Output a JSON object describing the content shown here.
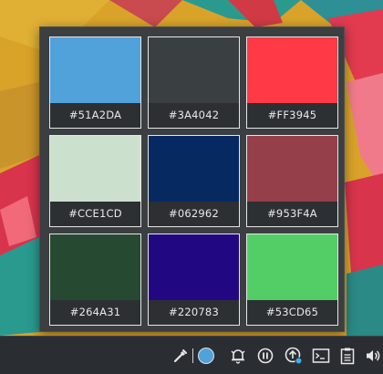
{
  "palette": {
    "swatches": [
      {
        "hex": "#51A2DA",
        "label": "#51A2DA"
      },
      {
        "hex": "#3A4042",
        "label": "#3A4042"
      },
      {
        "hex": "#FF3945",
        "label": "#FF3945"
      },
      {
        "hex": "#CCE1CD",
        "label": "#CCE1CD"
      },
      {
        "hex": "#062962",
        "label": "#062962"
      },
      {
        "hex": "#953F4A",
        "label": "#953F4A"
      },
      {
        "hex": "#264A31",
        "label": "#264A31"
      },
      {
        "hex": "#220783",
        "label": "#220783"
      },
      {
        "hex": "#53CD65",
        "label": "#53CD65"
      }
    ]
  },
  "taskbar": {
    "icons": [
      "color-picker-icon",
      "current-color-icon",
      "notifications-bell-icon",
      "media-pause-icon",
      "updates-icon",
      "terminal-icon",
      "clipboard-icon",
      "volume-icon"
    ],
    "current_color": "#51A2DA",
    "badge_color": "#3daee9"
  },
  "colors": {
    "popup_bg": "#3b3f42",
    "taskbar_bg": "#2a2e32"
  }
}
